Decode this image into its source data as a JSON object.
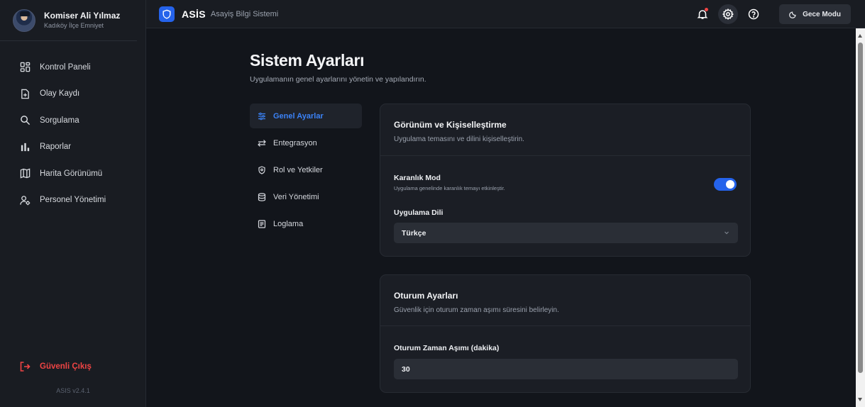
{
  "user": {
    "name": "Komiser Ali Yılmaz",
    "unit": "Kadıköy İlçe Emniyet"
  },
  "sidebar": {
    "items": [
      {
        "label": "Kontrol Paneli",
        "icon": "dashboard-icon"
      },
      {
        "label": "Olay Kaydı",
        "icon": "file-plus-icon"
      },
      {
        "label": "Sorgulama",
        "icon": "search-icon"
      },
      {
        "label": "Raporlar",
        "icon": "bar-chart-icon"
      },
      {
        "label": "Harita Görünümü",
        "icon": "map-icon"
      },
      {
        "label": "Personel Yönetimi",
        "icon": "users-cog-icon"
      }
    ],
    "logout_label": "Güvenli Çıkış",
    "version": "ASIS v2.4.1"
  },
  "header": {
    "brand": "ASİS",
    "subtitle": "Asayiş Bilgi Sistemi",
    "night_mode_label": "Gece Modu"
  },
  "page": {
    "title": "Sistem Ayarları",
    "subtitle": "Uygulamanın genel ayarlarını yönetin ve yapılandırın."
  },
  "settings_nav": [
    {
      "label": "Genel Ayarlar",
      "icon": "sliders-icon",
      "active": true
    },
    {
      "label": "Entegrasyon",
      "icon": "arrows-swap-icon",
      "active": false
    },
    {
      "label": "Rol ve Yetkiler",
      "icon": "shield-icon",
      "active": false
    },
    {
      "label": "Veri Yönetimi",
      "icon": "database-icon",
      "active": false
    },
    {
      "label": "Loglama",
      "icon": "log-list-icon",
      "active": false
    }
  ],
  "appearance": {
    "title": "Görünüm ve Kişiselleştirme",
    "description": "Uygulama temasını ve dilini kişiselleştirin.",
    "dark_mode_label": "Karanlık Mod",
    "dark_mode_help": "Uygulama genelinde karanlık temayı etkinleştir.",
    "dark_mode_on": true,
    "language_label": "Uygulama Dili",
    "language_value": "Türkçe"
  },
  "session": {
    "title": "Oturum Ayarları",
    "description": "Güvenlik için oturum zaman aşımı süresini belirleyin.",
    "timeout_label": "Oturum Zaman Aşımı (dakika)",
    "timeout_value": "30"
  },
  "colors": {
    "accent": "#2563eb",
    "danger": "#ef4444",
    "background": "#12151b",
    "panel": "#1b1e25"
  }
}
